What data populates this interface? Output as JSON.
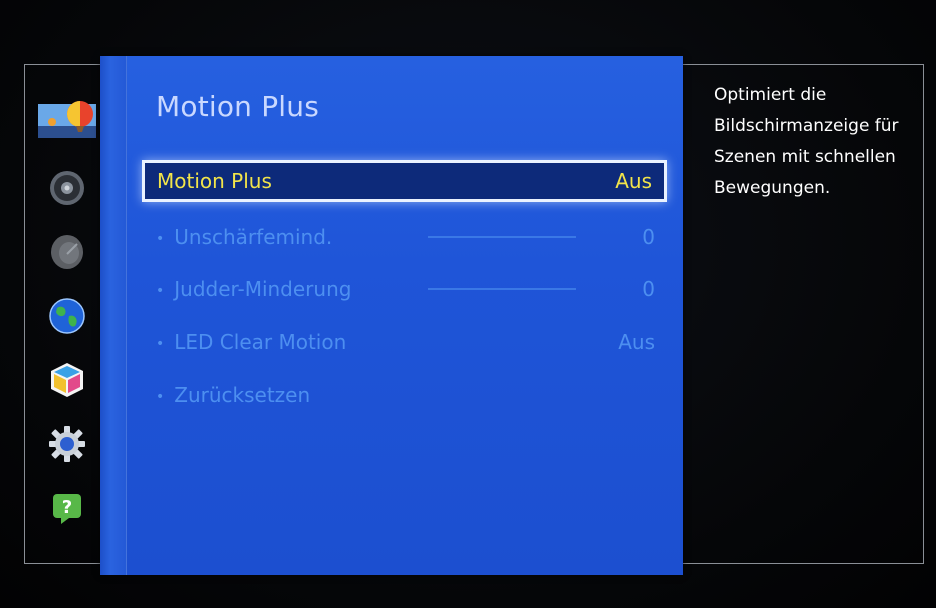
{
  "panel": {
    "title": "Motion Plus"
  },
  "menu": {
    "items": [
      {
        "label": "Motion Plus",
        "value": "Aus"
      },
      {
        "label": "Unschärfemind.",
        "value": "0",
        "slider": 0
      },
      {
        "label": "Judder-Minderung",
        "value": "0",
        "slider": 0
      },
      {
        "label": "LED Clear Motion",
        "value": "Aus"
      },
      {
        "label": "Zurücksetzen",
        "value": ""
      }
    ],
    "bullet": "•"
  },
  "description": {
    "lines": [
      "Optimiert die",
      "Bildschirmanzeige für",
      "Szenen mit schnellen",
      "Bewegungen."
    ]
  },
  "sidebar": {
    "icons": [
      "picture-icon",
      "speaker-icon",
      "satellite-dish-icon",
      "globe-icon",
      "smart-hub-cube-icon",
      "gear-icon",
      "help-icon"
    ]
  },
  "colors": {
    "panel_blue": "#1f55d8",
    "selected_text": "#f2e44a",
    "dim_text": "#4d8ff0"
  }
}
